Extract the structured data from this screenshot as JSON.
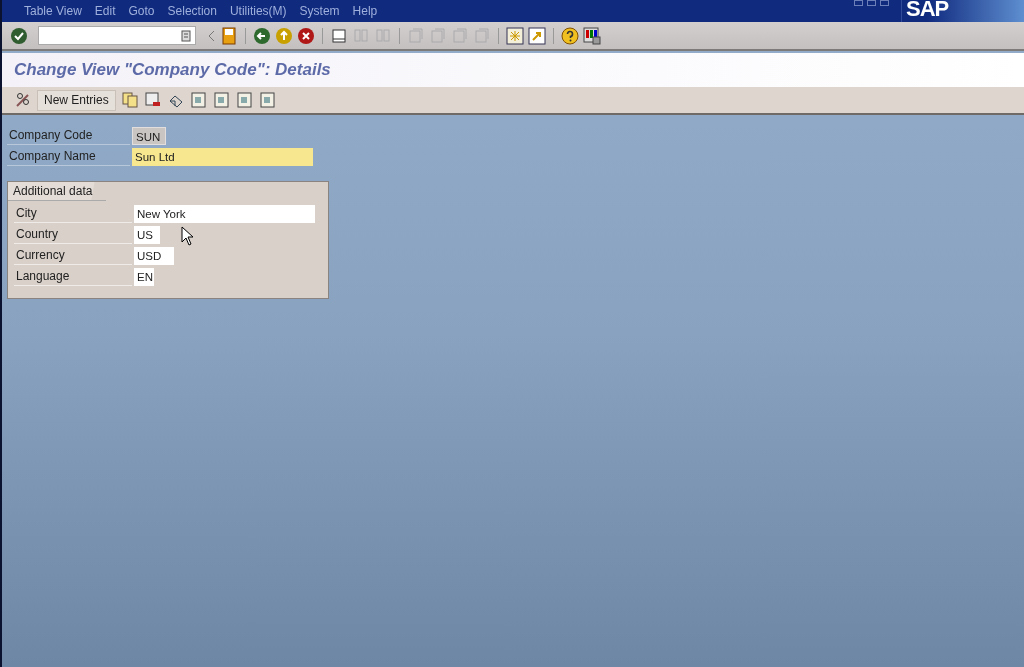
{
  "menu": [
    "Table View",
    "Edit",
    "Goto",
    "Selection",
    "Utilities(M)",
    "System",
    "Help"
  ],
  "logo": "SAP",
  "title": "Change View \"Company Code\": Details",
  "app_toolbar": {
    "new_entries": "New Entries"
  },
  "header_fields": [
    {
      "label": "Company Code",
      "value": "SUN",
      "kind": "readonly"
    },
    {
      "label": "Company Name",
      "value": "Sun Ltd",
      "kind": "highlighted"
    }
  ],
  "group": {
    "title": "Additional data",
    "fields": [
      {
        "label": "City",
        "value": "New York",
        "kind": "input"
      },
      {
        "label": "Country",
        "value": "US",
        "kind": "input"
      },
      {
        "label": "Currency",
        "value": "USD",
        "kind": "input"
      },
      {
        "label": "Language",
        "value": "EN",
        "kind": "input"
      }
    ]
  }
}
